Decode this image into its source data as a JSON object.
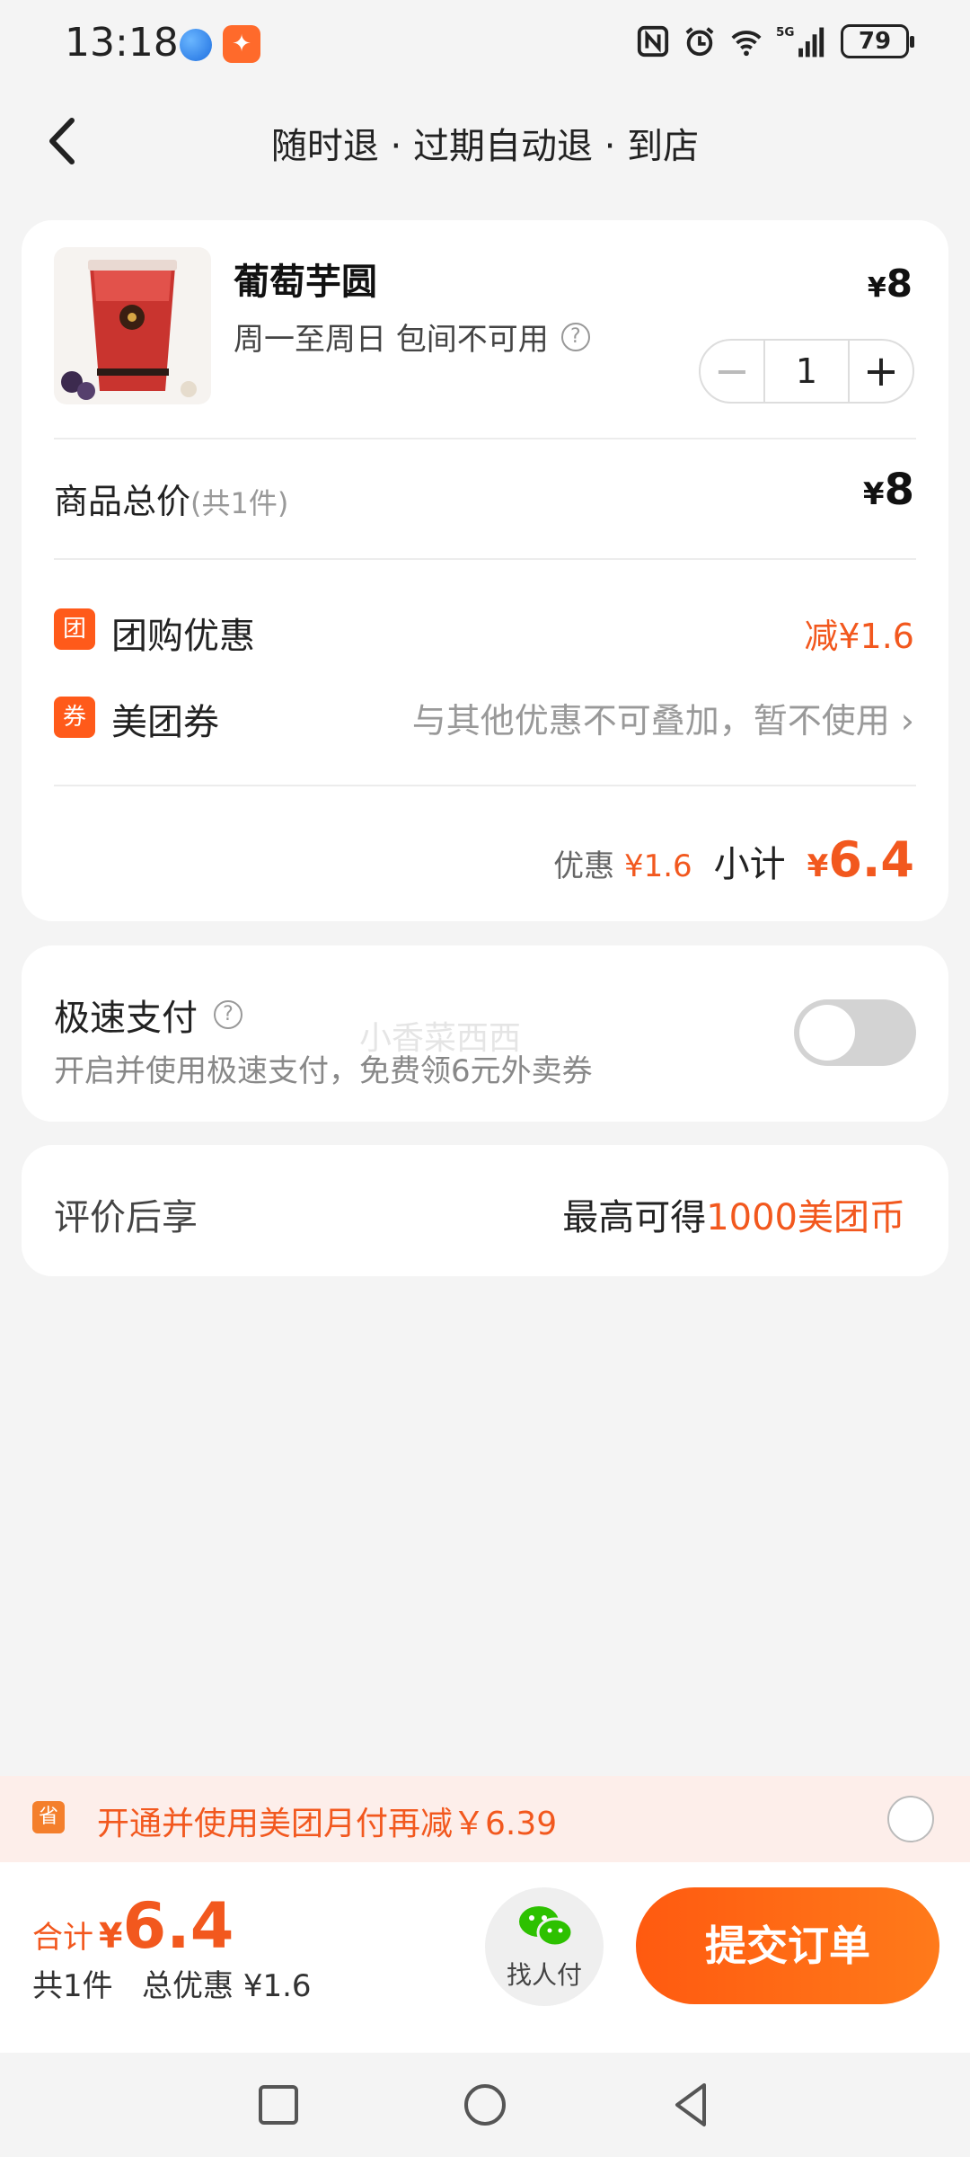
{
  "status_bar": {
    "time": "13:18",
    "network": "5G",
    "battery": "79"
  },
  "header": {
    "title": "随时退 · 过期自动退 · 到店"
  },
  "product": {
    "name": "葡萄芋圆",
    "desc": "周一至周日 包间不可用",
    "currency": "¥",
    "price": "8",
    "quantity": "1"
  },
  "totals": {
    "label": "商品总价",
    "count_note": "(共1件)",
    "currency": "¥",
    "price": "8"
  },
  "discounts": [
    {
      "badge": "团",
      "label": "团购优惠",
      "value": "减¥1.6"
    },
    {
      "badge": "券",
      "label": "美团券",
      "value": "与其他优惠不可叠加，暂不使用"
    }
  ],
  "subtotal": {
    "discount_label": "优惠",
    "discount_value": "¥1.6",
    "label": "小计",
    "currency": "¥",
    "value": "6.4"
  },
  "fast_pay": {
    "title": "极速支付",
    "subtitle": "开启并使用极速支付，免费领6元外卖券",
    "enabled": false
  },
  "watermark": "小香菜西西",
  "review": {
    "label": "评价后享",
    "prefix": "最高可得",
    "highlight": "1000美团币"
  },
  "promo": {
    "icon": "省",
    "text": "开通并使用美团月付再减￥6.39"
  },
  "footer": {
    "sum_label": "合计",
    "currency": "¥",
    "sum_value": "6.4",
    "sub": "共1件   总优惠 ¥1.6",
    "friend_pay": "找人付",
    "submit": "提交订单"
  },
  "colors": {
    "accent": "#f2581e",
    "button": "#ff5a10"
  }
}
